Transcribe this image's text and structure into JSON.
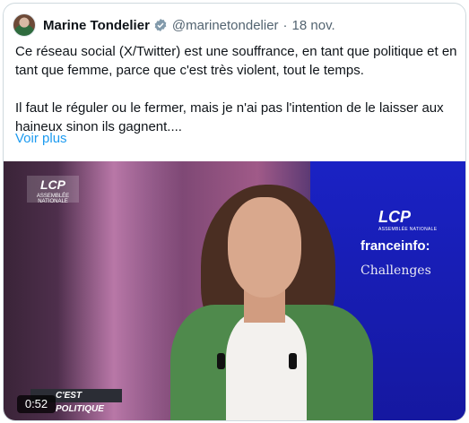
{
  "author": {
    "name": "Marine Tondelier",
    "handle": "@marinetondelier",
    "date": "18 nov."
  },
  "tweet": {
    "paragraph1": "Ce réseau social (X/Twitter) est une souffrance, en tant que politique et en tant que femme, parce que c'est très violent, tout le temps.",
    "paragraph2": "Il faut le réguler ou le fermer, mais je n'ai pas l'intention de le laisser aux haineux sinon ils gagnent....",
    "show_more": "Voir plus"
  },
  "media": {
    "duration": "0:52",
    "logo_small": "LCP",
    "logo_small_sub": "ASSEMBLÉE NATIONALE",
    "logo_big": "LCP",
    "logo_big_sub": "ASSEMBLÉE NATIONALE",
    "partner1": "franceinfo:",
    "partner2": "Challenges",
    "banner": "C'EST POLITIQUE"
  },
  "colors": {
    "link": "#1d9bf0",
    "verified": "#829aab",
    "studio_blue": "#1a22c4"
  },
  "icons": {
    "verified": "verified-badge-icon"
  }
}
